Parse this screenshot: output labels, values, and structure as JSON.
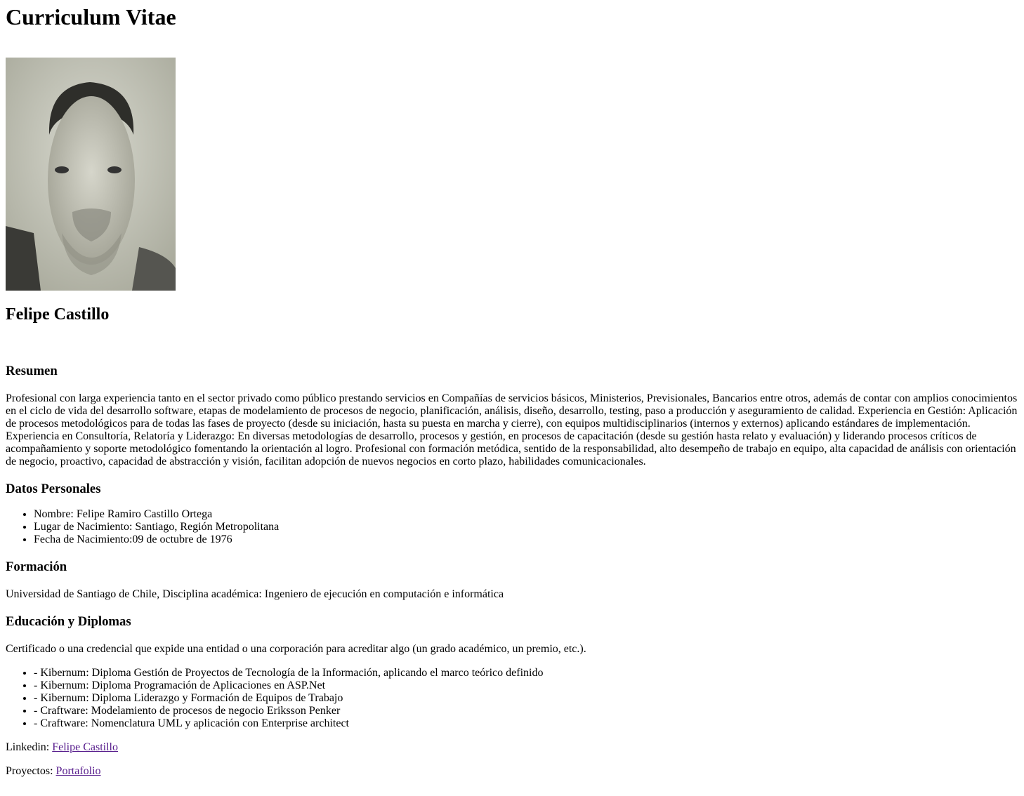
{
  "title": "Curriculum Vitae",
  "name": "Felipe Castillo",
  "resumen": {
    "heading": "Resumen",
    "text1": "Profesional con larga experiencia tanto en el sector privado como público prestando servicios en Compañías de servicios básicos, Ministerios, Previsionales, Bancarios entre otros, además de contar con amplios conocimientos en el ciclo de vida del desarrollo software, etapas de modelamiento de procesos de negocio, planificación, análisis, diseño, desarrollo, testing, paso a producción y aseguramiento de calidad. Experiencia en Gestión: Aplicación de procesos metodológicos para de todas las fases de proyecto (desde su iniciación, hasta su puesta en marcha y cierre), con equipos multidisciplinarios (internos y externos) aplicando estándares de implementación.",
    "text2": "Experiencia en Consultoría, Relatoría y Liderazgo: En diversas metodologías de desarrollo, procesos y gestión, en procesos de capacitación (desde su gestión hasta relato y evaluación) y liderando procesos críticos de acompañamiento y soporte metodológico fomentando la orientación al logro. Profesional con formación metódica, sentido de la responsabilidad, alto desempeño de trabajo en equipo, alta capacidad de análisis con orientación de negocio, proactivo, capacidad de abstracción y visión, facilitan adopción de nuevos negocios en corto plazo, habilidades comunicacionales."
  },
  "datos": {
    "heading": "Datos Personales",
    "items": [
      "Nombre: Felipe Ramiro Castillo Ortega",
      "Lugar de Nacimiento: Santiago, Región Metropolitana",
      "Fecha de Nacimiento:09 de octubre de 1976"
    ]
  },
  "formacion": {
    "heading": "Formación",
    "text": "Universidad de Santiago de Chile, Disciplina académica: Ingeniero de ejecución en computación e informática"
  },
  "educacion": {
    "heading": "Educación y Diplomas",
    "text": "Certificado o una credencial que expide una entidad o una corporación para acreditar algo (un grado académico, un premio, etc.).",
    "items": [
      "- Kibernum: Diploma Gestión de Proyectos de Tecnología de la Información, aplicando el marco teórico definido",
      "- Kibernum: Diploma Programación de Aplicaciones en ASP.Net",
      "- Kibernum: Diploma Liderazgo y Formación de Equipos de Trabajo",
      "- Craftware: Modelamiento de procesos de negocio Eriksson Penker",
      "- Craftware: Nomenclatura UML y aplicación con Enterprise architect"
    ]
  },
  "linkedin": {
    "label": "Linkedin: ",
    "link": "Felipe Castillo"
  },
  "proyectos": {
    "label": "Proyectos: ",
    "link": "Portafolio"
  }
}
